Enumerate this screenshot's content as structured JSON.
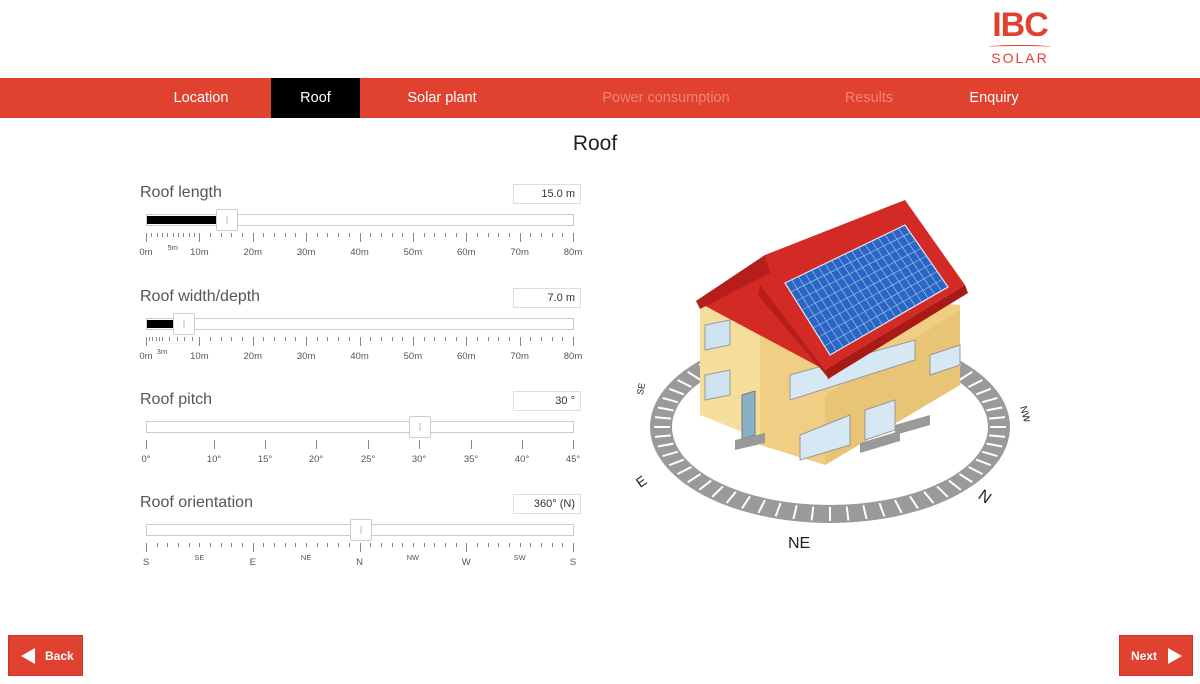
{
  "logo": {
    "top": "IBC",
    "bottom": "SOLAR"
  },
  "nav": {
    "tabs": [
      {
        "label": "Location",
        "state": "normal"
      },
      {
        "label": "Roof",
        "state": "active"
      },
      {
        "label": "Solar plant",
        "state": "normal"
      },
      {
        "label": "Power consumption",
        "state": "disabled"
      },
      {
        "label": "Results",
        "state": "disabled"
      },
      {
        "label": "Enquiry",
        "state": "normal"
      }
    ]
  },
  "title": "Roof",
  "sliders": {
    "length": {
      "label": "Roof length",
      "value_text": "15.0 m",
      "value": 15,
      "min": 0,
      "max": 80,
      "ticks": [
        "0m",
        "5m",
        "10m",
        "20m",
        "30m",
        "40m",
        "50m",
        "60m",
        "70m",
        "80m"
      ]
    },
    "width": {
      "label": "Roof width/depth",
      "value_text": "7.0 m",
      "value": 7,
      "min": 0,
      "max": 80,
      "ticks": [
        "0m",
        "3m",
        "10m",
        "20m",
        "30m",
        "40m",
        "50m",
        "60m",
        "70m",
        "80m"
      ]
    },
    "pitch": {
      "label": "Roof pitch",
      "value_text": "30 °",
      "value": 30,
      "min": 0,
      "max": 45,
      "ticks": [
        "0°",
        "10°",
        "15°",
        "20°",
        "25°",
        "30°",
        "35°",
        "40°",
        "45°"
      ]
    },
    "orientation": {
      "label": "Roof orientation",
      "value_text": "360° (N)",
      "value": 0.5,
      "ticks": [
        "S",
        "SE",
        "E",
        "NE",
        "N",
        "NW",
        "W",
        "SW",
        "S"
      ]
    }
  },
  "compass": {
    "labels": [
      "NE",
      "N",
      "NW",
      "E",
      "SE"
    ]
  },
  "buttons": {
    "back": "Back",
    "next": "Next"
  },
  "colors": {
    "accent": "#e14230",
    "active_tab": "#000000",
    "roof": "#d42a25",
    "walls": "#f3d48f",
    "panels": "#2b66c4"
  }
}
